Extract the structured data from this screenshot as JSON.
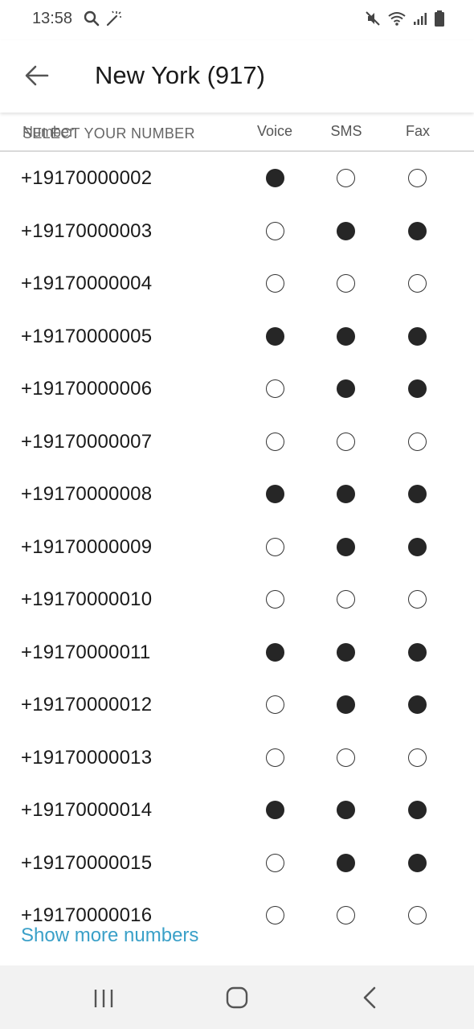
{
  "status_bar": {
    "time": "13:58",
    "left_icons": [
      "search-icon",
      "magic-wand-icon"
    ],
    "right_icons": [
      "mute-icon",
      "wifi-icon",
      "signal-icon",
      "battery-icon"
    ]
  },
  "app_bar": {
    "title": "New York (917)",
    "back_icon": "arrow-left-icon"
  },
  "table_header": {
    "number_label": "Number",
    "select_label": "SELECT YOUR NUMBER",
    "columns": [
      "Voice",
      "SMS",
      "Fax"
    ]
  },
  "numbers": [
    {
      "number": "+19170000002",
      "voice": true,
      "sms": false,
      "fax": false
    },
    {
      "number": "+19170000003",
      "voice": false,
      "sms": true,
      "fax": true
    },
    {
      "number": "+19170000004",
      "voice": false,
      "sms": false,
      "fax": false
    },
    {
      "number": "+19170000005",
      "voice": true,
      "sms": true,
      "fax": true
    },
    {
      "number": "+19170000006",
      "voice": false,
      "sms": true,
      "fax": true
    },
    {
      "number": "+19170000007",
      "voice": false,
      "sms": false,
      "fax": false
    },
    {
      "number": "+19170000008",
      "voice": true,
      "sms": true,
      "fax": true
    },
    {
      "number": "+19170000009",
      "voice": false,
      "sms": true,
      "fax": true
    },
    {
      "number": "+19170000010",
      "voice": false,
      "sms": false,
      "fax": false
    },
    {
      "number": "+19170000011",
      "voice": true,
      "sms": true,
      "fax": true
    },
    {
      "number": "+19170000012",
      "voice": false,
      "sms": true,
      "fax": true
    },
    {
      "number": "+19170000013",
      "voice": false,
      "sms": false,
      "fax": false
    },
    {
      "number": "+19170000014",
      "voice": true,
      "sms": true,
      "fax": true
    },
    {
      "number": "+19170000015",
      "voice": false,
      "sms": true,
      "fax": true
    },
    {
      "number": "+19170000016",
      "voice": false,
      "sms": false,
      "fax": false
    }
  ],
  "show_more_label": "Show more numbers",
  "colors": {
    "accent": "#3aa0c8",
    "radio_filled": "#262626",
    "nav_bar_bg": "#f2f2f2"
  },
  "nav_bar": [
    "recent-apps-icon",
    "home-icon",
    "back-icon"
  ]
}
